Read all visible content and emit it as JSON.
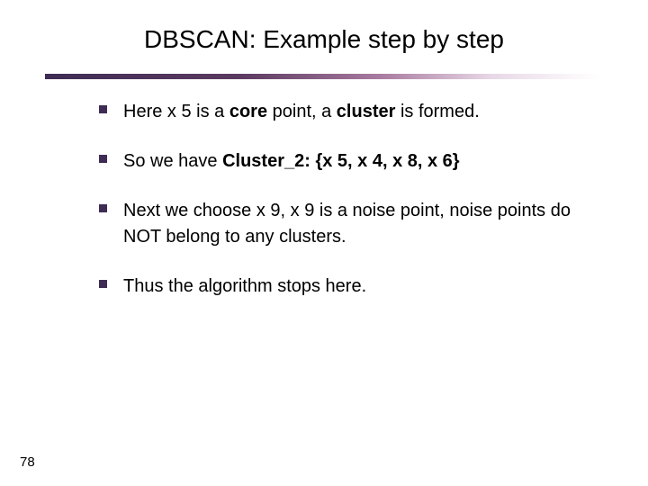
{
  "title": "DBSCAN: Example step by step",
  "bullets": [
    {
      "pre": "Here x 5 is a ",
      "b1": "core",
      " mid1": " point, a ",
      "b2": "cluster",
      "post": " is formed."
    },
    {
      "pre": "So we have ",
      "b1": "Cluster_2: {x 5, x 4, x 8, x 6}",
      "mid1": "",
      "b2": "",
      "post": ""
    },
    {
      "pre": "Next we choose x 9, x 9 is a noise point, noise points do NOT belong to any clusters.",
      "b1": "",
      "mid1": "",
      "b2": "",
      "post": ""
    },
    {
      "pre": "Thus the algorithm stops here.",
      "b1": "",
      "mid1": "",
      "b2": "",
      "post": ""
    }
  ],
  "page": "78"
}
